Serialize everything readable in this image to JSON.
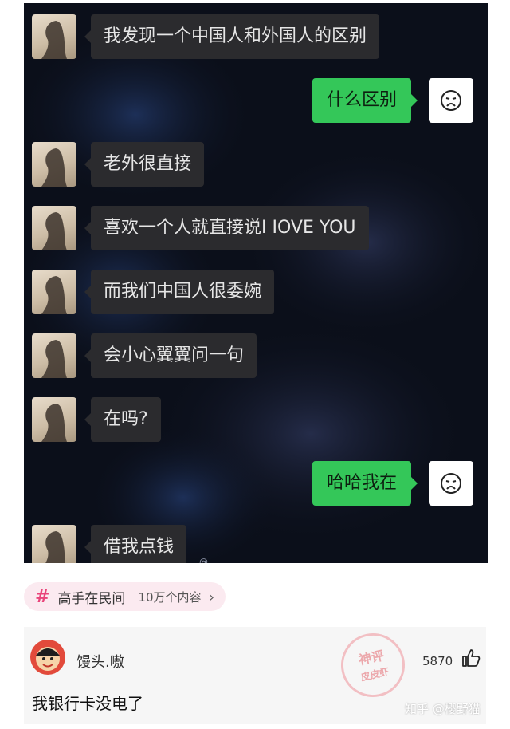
{
  "chat": {
    "messages": [
      {
        "side": "left",
        "text": "我发现一个中国人和外国人的区别"
      },
      {
        "side": "right",
        "text": "什么区别"
      },
      {
        "side": "left",
        "text": "老外很直接"
      },
      {
        "side": "left",
        "text": "喜欢一个人就直接说I IOVE  YOU"
      },
      {
        "side": "left",
        "text": "而我们中国人很委婉"
      },
      {
        "side": "left",
        "text": "会小心翼翼问一句"
      },
      {
        "side": "left",
        "text": "在吗?"
      },
      {
        "side": "right",
        "text": "哈哈我在"
      },
      {
        "side": "left",
        "text": "借我点钱"
      }
    ],
    "self_avatar_icon": "crying-face-icon",
    "watermark": "@"
  },
  "topic": {
    "hash": "#",
    "title": "高手在民间",
    "count": "10万个内容",
    "chevron": "›"
  },
  "comment": {
    "username": "馒头.嗷",
    "text": "我银行卡没电了",
    "like_count": "5870",
    "stamp_top": "神评",
    "stamp_bottom": "皮皮虾",
    "like_icon": "thumbs-up-icon"
  },
  "zhihu": {
    "text": "知乎 @樱野猫"
  },
  "colors": {
    "chat_bg": "#0b0f1a",
    "bubble_in": "#2b2b2e",
    "bubble_out": "#34c759",
    "topic_accent": "#e9447a"
  }
}
